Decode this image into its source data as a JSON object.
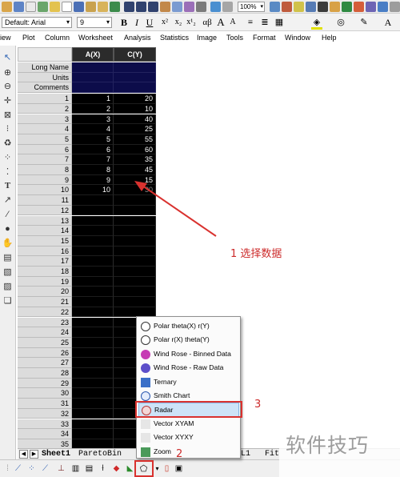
{
  "toolbar_top": {
    "zoom_value": "100%"
  },
  "format_toolbar": {
    "font_label": "Default: Arial",
    "font_size": "9",
    "bold": "B",
    "italic": "I",
    "underline": "U",
    "superscript": "x²",
    "subscript": "x₂",
    "supsub": "x¹₂",
    "greek": "αβ",
    "grow_font": "A",
    "shrink_font": "A"
  },
  "menu": {
    "items": [
      "iew",
      "Plot",
      "Column",
      "Worksheet",
      "Analysis",
      "Statistics",
      "Image",
      "Tools",
      "Format",
      "Window",
      "Help"
    ]
  },
  "worksheet": {
    "columns": [
      "A(X)",
      "C(Y)"
    ],
    "header_rows": [
      "Long Name",
      "Units",
      "Comments"
    ],
    "row_numbers": [
      "1",
      "2",
      "3",
      "4",
      "5",
      "6",
      "7",
      "8",
      "9",
      "10",
      "11",
      "12",
      "13",
      "14",
      "15",
      "16",
      "17",
      "18",
      "19",
      "20",
      "21",
      "22",
      "23",
      "24",
      "25",
      "26",
      "27",
      "28",
      "29",
      "30",
      "31",
      "32",
      "33",
      "34",
      "35"
    ],
    "col_a": [
      "1",
      "2",
      "3",
      "4",
      "5",
      "6",
      "7",
      "8",
      "9",
      "10"
    ],
    "col_c": [
      "20",
      "10",
      "40",
      "25",
      "55",
      "60",
      "35",
      "45",
      "15",
      ""
    ],
    "col_c_partial_row10": "30"
  },
  "tabs": {
    "sheet1": "Sheet1",
    "paretobin": "ParetoBin",
    "right_fragment": "L1",
    "right_fragment2": "Fit"
  },
  "popup": {
    "items": [
      "Polar theta(X) r(Y)",
      "Polar r(X) theta(Y)",
      "Wind Rose - Binned Data",
      "Wind Rose - Raw Data",
      "Ternary",
      "Smith Chart",
      "Radar",
      "Vector XYAM",
      "Vector  XYXY",
      "Zoom"
    ],
    "selected": "Radar"
  },
  "annotations": {
    "step1": "1  选择数据",
    "step2": "2",
    "step3": "3",
    "watermark": "软件技巧"
  },
  "colors": {
    "accent_red": "#d9322f",
    "selection_blue": "#cde3f7",
    "header_navy": "#0c0c4a"
  }
}
